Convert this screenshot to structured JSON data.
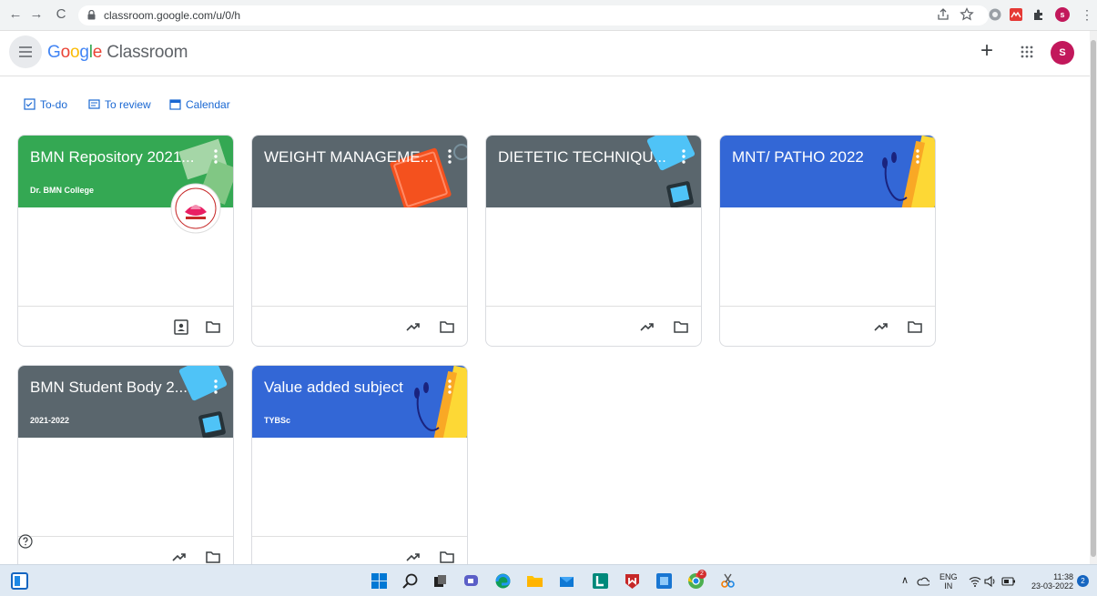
{
  "browser": {
    "url": "classroom.google.com/u/0/h",
    "profile_initial": "s"
  },
  "app": {
    "brand_google": [
      "G",
      "o",
      "o",
      "g",
      "l",
      "e"
    ],
    "brand_colors": [
      "#4285f4",
      "#ea4335",
      "#fbbc05",
      "#4285f4",
      "#34a853",
      "#ea4335"
    ],
    "brand_product": "Classroom",
    "avatar_initial": "S",
    "avatar_color": "#c2185b"
  },
  "quick_links": {
    "todo": "To-do",
    "review": "To review",
    "calendar": "Calendar",
    "color": "#1967d2"
  },
  "classes": [
    {
      "title": "BMN Repository 2021...",
      "subtitle": "Dr. BMN College",
      "color": "#34a853",
      "icons": [
        "assignment-ind-icon",
        "folder-icon"
      ]
    },
    {
      "title": "WEIGHT MANAGEME...",
      "subtitle": "",
      "color": "#5a666d",
      "icons": [
        "trending-icon",
        "folder-icon"
      ]
    },
    {
      "title": "DIETETIC TECHNIQU...",
      "subtitle": "",
      "color": "#5a666d",
      "icons": [
        "trending-icon",
        "folder-icon"
      ]
    },
    {
      "title": "MNT/ PATHO 2022",
      "subtitle": "",
      "color": "#3367d6",
      "icons": [
        "trending-icon",
        "folder-icon"
      ]
    },
    {
      "title": "BMN Student Body 2...",
      "subtitle": "2021-2022",
      "color": "#5a666d",
      "icons": [
        "trending-icon",
        "folder-icon"
      ]
    },
    {
      "title": "Value added subject",
      "subtitle": "TYBSc",
      "color": "#3367d6",
      "icons": [
        "trending-icon",
        "folder-icon"
      ]
    }
  ],
  "taskbar": {
    "lang_top": "ENG",
    "lang_bottom": "IN",
    "time": "11:38",
    "date": "23-03-2022",
    "notification_count": "2",
    "chrome_badge": "2"
  }
}
